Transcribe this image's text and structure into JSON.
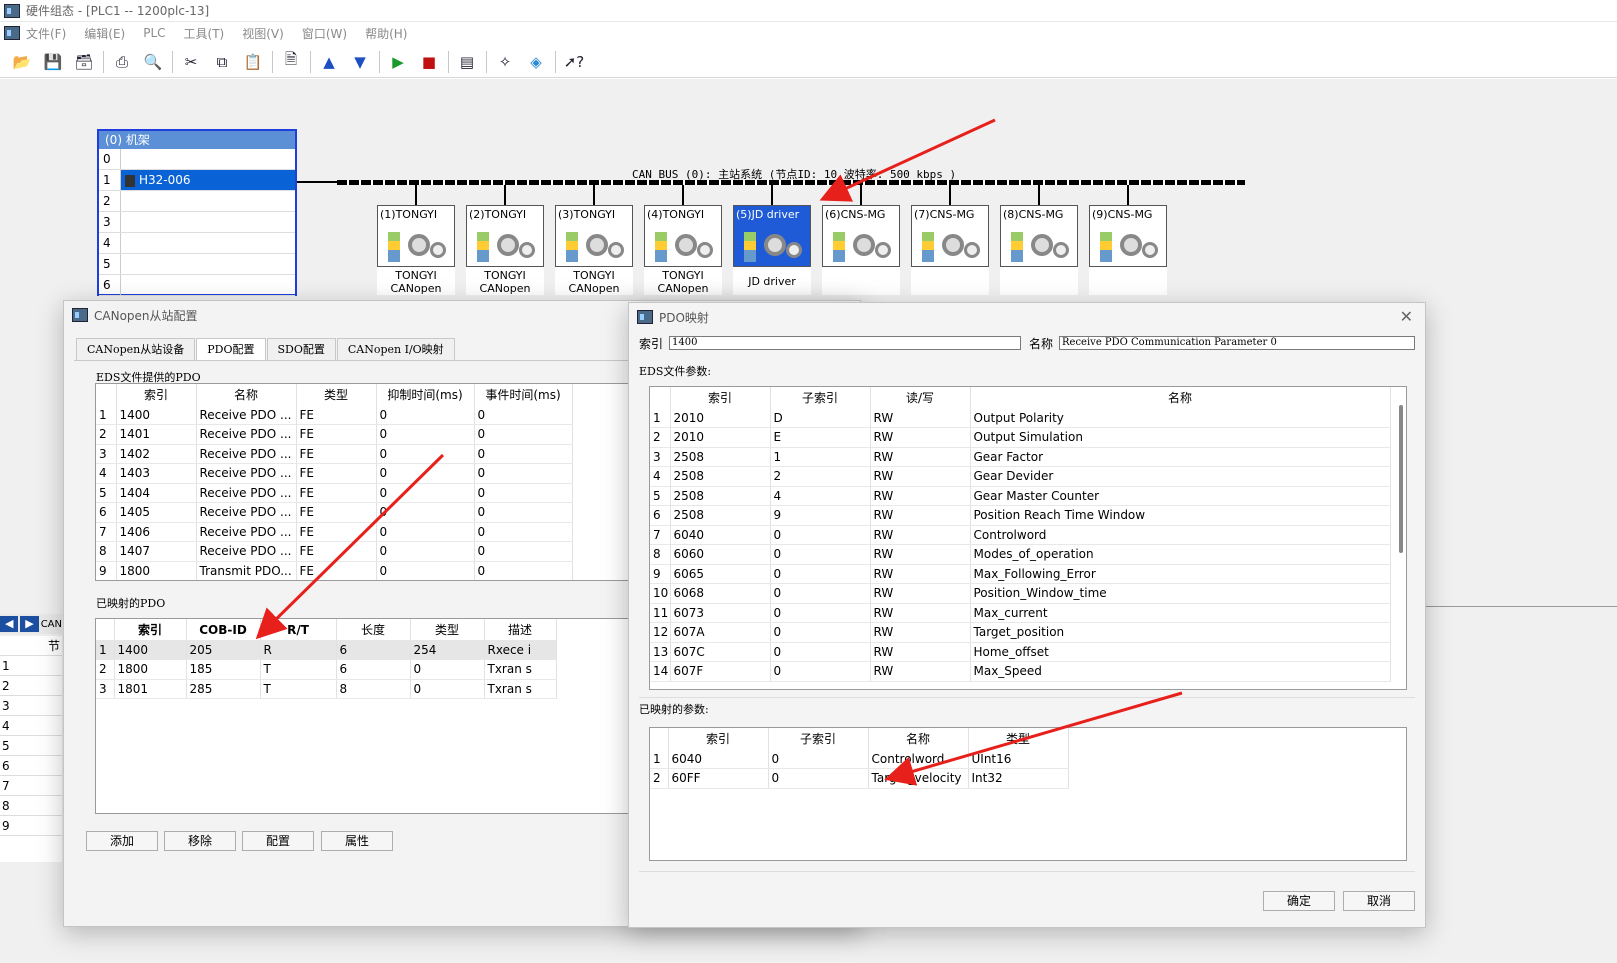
{
  "window": {
    "title": "硬件组态 - [PLC1 -- 1200plc-13]"
  },
  "menu": [
    "文件(F)",
    "编辑(E)",
    "PLC",
    "工具(T)",
    "视图(V)",
    "窗口(W)",
    "帮助(H)"
  ],
  "rack": {
    "title": "(0) 机架",
    "rows": [
      {
        "n": "0",
        "v": ""
      },
      {
        "n": "1",
        "v": "H32-006"
      },
      {
        "n": "2",
        "v": ""
      },
      {
        "n": "3",
        "v": ""
      },
      {
        "n": "4",
        "v": ""
      },
      {
        "n": "5",
        "v": ""
      },
      {
        "n": "6",
        "v": ""
      }
    ]
  },
  "bus": {
    "label": "CAN BUS (0): 主站系统    (节点ID: 10  波特率: 500 kbps )"
  },
  "nodes": [
    {
      "h": "(1)TONGYI",
      "l1": "TONGYI",
      "l2": "CANopen"
    },
    {
      "h": "(2)TONGYI",
      "l1": "TONGYI",
      "l2": "CANopen"
    },
    {
      "h": "(3)TONGYI",
      "l1": "TONGYI",
      "l2": "CANopen"
    },
    {
      "h": "(4)TONGYI",
      "l1": "TONGYI",
      "l2": "CANopen"
    },
    {
      "h": "(5)JD driver",
      "l1": "JD driver",
      "l2": ""
    },
    {
      "h": "(6)CNS-MG",
      "l1": "",
      "l2": ""
    },
    {
      "h": "(7)CNS-MG",
      "l1": "",
      "l2": ""
    },
    {
      "h": "(8)CNS-MG",
      "l1": "",
      "l2": ""
    },
    {
      "h": "(9)CNS-MG",
      "l1": "",
      "l2": ""
    }
  ],
  "leftlist": {
    "header": "CAN",
    "col": "节",
    "rows": [
      "1",
      "2",
      "3",
      "4",
      "5",
      "6",
      "7",
      "8",
      "9"
    ]
  },
  "canopen": {
    "title": "CANopen从站配置",
    "tabs": [
      "CANopen从站设备",
      "PDO配置",
      "SDO配置",
      "CANopen I/O映射"
    ],
    "eds_group": "EDS文件提供的PDO",
    "eds_cols": [
      "索引",
      "名称",
      "类型",
      "抑制时间(ms)",
      "事件时间(ms)"
    ],
    "eds_rows": [
      [
        "1",
        "1400",
        "Receive PDO ...",
        "FE",
        "0",
        "0"
      ],
      [
        "2",
        "1401",
        "Receive PDO ...",
        "FE",
        "0",
        "0"
      ],
      [
        "3",
        "1402",
        "Receive PDO ...",
        "FE",
        "0",
        "0"
      ],
      [
        "4",
        "1403",
        "Receive PDO ...",
        "FE",
        "0",
        "0"
      ],
      [
        "5",
        "1404",
        "Receive PDO ...",
        "FE",
        "0",
        "0"
      ],
      [
        "6",
        "1405",
        "Receive PDO ...",
        "FE",
        "0",
        "0"
      ],
      [
        "7",
        "1406",
        "Receive PDO ...",
        "FE",
        "0",
        "0"
      ],
      [
        "8",
        "1407",
        "Receive PDO ...",
        "FE",
        "0",
        "0"
      ],
      [
        "9",
        "1800",
        "Transmit PDO...",
        "FE",
        "0",
        "0"
      ]
    ],
    "mapped_group": "已映射的PDO",
    "mapped_cols": [
      "索引",
      "COB-ID",
      "R/T",
      "长度",
      "类型",
      "描述"
    ],
    "mapped_rows": [
      [
        "1",
        "1400",
        "205",
        "R",
        "6",
        "254",
        "Rxece i"
      ],
      [
        "2",
        "1800",
        "185",
        "T",
        "6",
        "0",
        "Txran s"
      ],
      [
        "3",
        "1801",
        "285",
        "T",
        "8",
        "0",
        "Txran s"
      ]
    ],
    "buttons": [
      "添加",
      "移除",
      "配置",
      "属性"
    ]
  },
  "pdo": {
    "title": "PDO映射",
    "index_label": "索引",
    "index_value": "1400",
    "name_label": "名称",
    "name_value": "Receive PDO Communication Parameter 0",
    "eds_label": "EDS文件参数:",
    "eds_cols": [
      "索引",
      "子索引",
      "读/写",
      "名称"
    ],
    "eds_rows": [
      [
        "1",
        "2010",
        "D",
        "RW",
        "Output Polarity"
      ],
      [
        "2",
        "2010",
        "E",
        "RW",
        "Output Simulation"
      ],
      [
        "3",
        "2508",
        "1",
        "RW",
        "Gear Factor"
      ],
      [
        "4",
        "2508",
        "2",
        "RW",
        "Gear Devider"
      ],
      [
        "5",
        "2508",
        "4",
        "RW",
        "Gear Master Counter"
      ],
      [
        "6",
        "2508",
        "9",
        "RW",
        "Position Reach Time Window"
      ],
      [
        "7",
        "6040",
        "0",
        "RW",
        "Controlword"
      ],
      [
        "8",
        "6060",
        "0",
        "RW",
        "Modes_of_operation"
      ],
      [
        "9",
        "6065",
        "0",
        "RW",
        "Max_Following_Error"
      ],
      [
        "10",
        "6068",
        "0",
        "RW",
        "Position_Window_time"
      ],
      [
        "11",
        "6073",
        "0",
        "RW",
        "Max_current"
      ],
      [
        "12",
        "607A",
        "0",
        "RW",
        "Target_position"
      ],
      [
        "13",
        "607C",
        "0",
        "RW",
        "Home_offset"
      ],
      [
        "14",
        "607F",
        "0",
        "RW",
        "Max_Speed"
      ]
    ],
    "mapped_label": "已映射的参数:",
    "mapped_cols": [
      "索引",
      "子索引",
      "名称",
      "类型"
    ],
    "mapped_rows": [
      [
        "1",
        "6040",
        "0",
        "Controlword",
        "UInt16"
      ],
      [
        "2",
        "60FF",
        "0",
        "Target_velocity",
        "Int32"
      ]
    ],
    "ok": "确定",
    "cancel": "取消"
  },
  "colors": {
    "selection": "#0a63d6",
    "rack_border": "#1e3fdc",
    "arrow": "#e8201c"
  }
}
